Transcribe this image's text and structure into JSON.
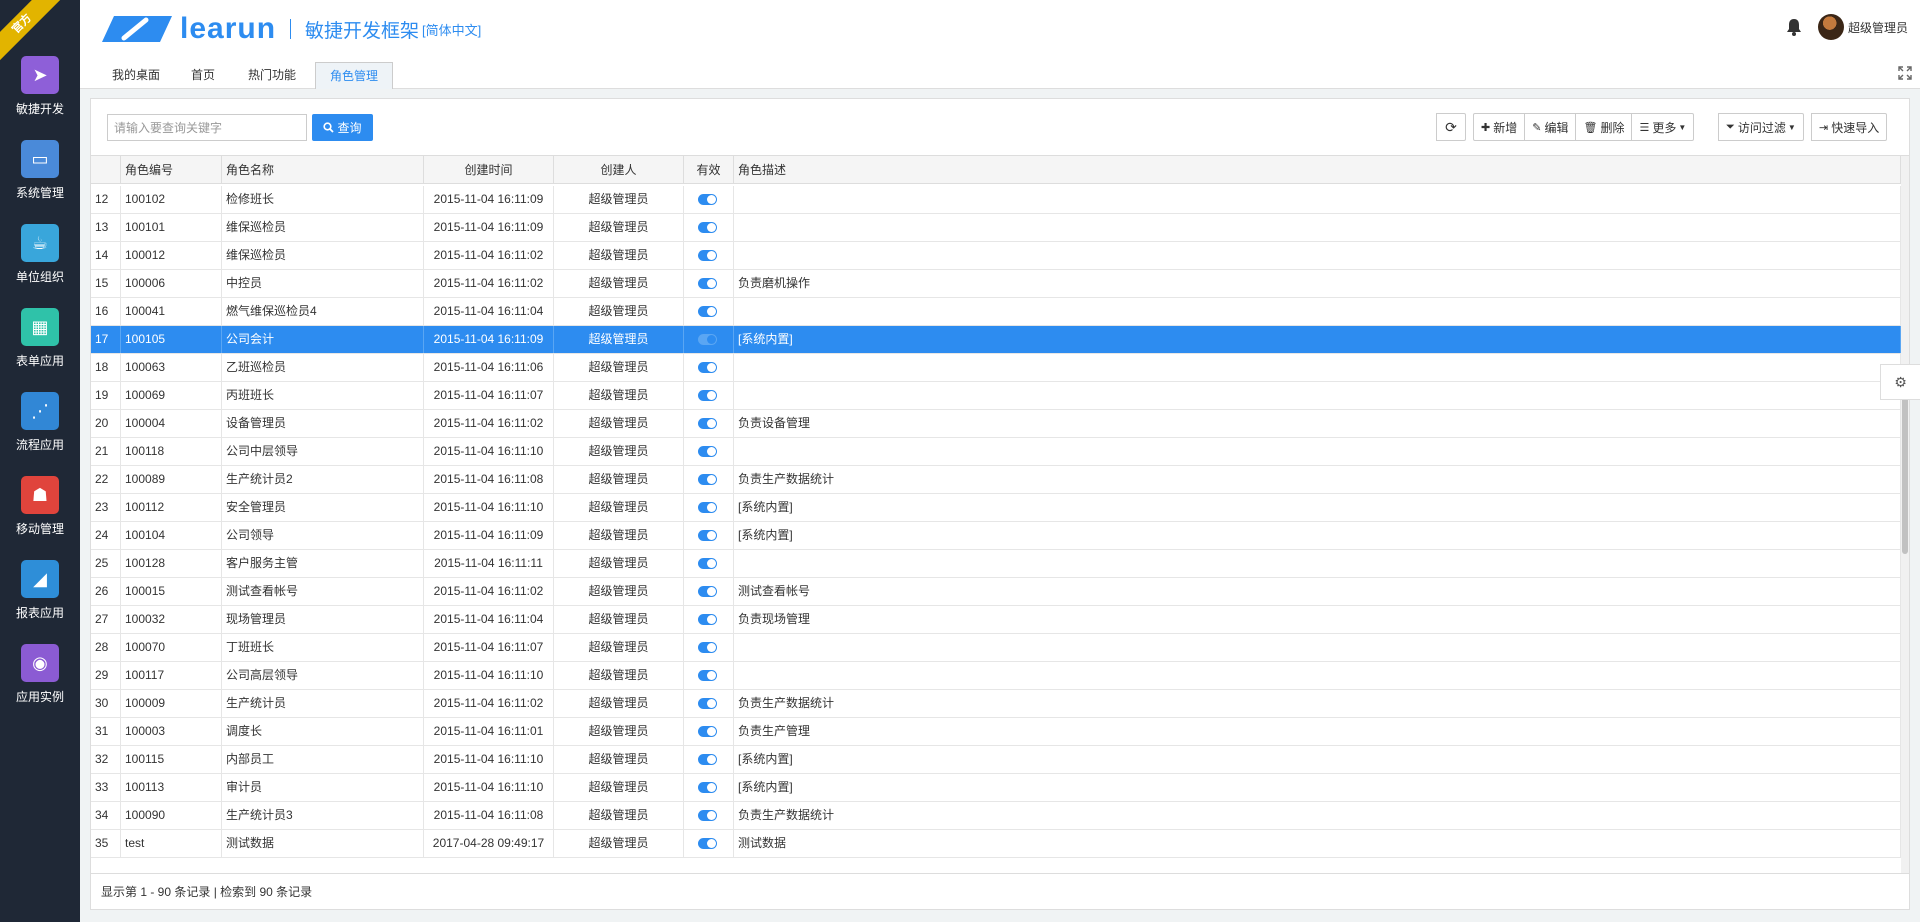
{
  "badge": "官方",
  "colors": {
    "accent": "#2d8cf0",
    "sidebar_bg": "#1f2836",
    "ribbon": "#e2b400"
  },
  "sidebar": {
    "items": [
      {
        "label": "敏捷开发",
        "icon": "paper-plane-icon",
        "color": "#8e5fd8"
      },
      {
        "label": "系统管理",
        "icon": "monitor-icon",
        "color": "#4a8ad9"
      },
      {
        "label": "单位组织",
        "icon": "coffee-icon",
        "color": "#39a6db"
      },
      {
        "label": "表单应用",
        "icon": "table-icon",
        "color": "#2fc2a9"
      },
      {
        "label": "流程应用",
        "icon": "share-icon",
        "color": "#3187d6"
      },
      {
        "label": "移动管理",
        "icon": "android-icon",
        "color": "#e0443c"
      },
      {
        "label": "报表应用",
        "icon": "chart-icon",
        "color": "#2e8ed8"
      },
      {
        "label": "应用实例",
        "icon": "globe-icon",
        "color": "#8b5bd3"
      }
    ]
  },
  "header": {
    "brand": "learun",
    "subtitle": "敏捷开发框架",
    "lang": "[简体中文]",
    "user": "超级管理员"
  },
  "tabs": [
    {
      "label": "我的桌面"
    },
    {
      "label": "首页"
    },
    {
      "label": "热门功能"
    },
    {
      "label": "角色管理",
      "active": true
    }
  ],
  "toolbar": {
    "search_placeholder": "请输入要查询关键字",
    "query": "查询",
    "refresh_icon": "refresh-icon",
    "add": "新增",
    "edit": "编辑",
    "delete": "删除",
    "more": "更多",
    "filter": "访问过滤",
    "import": "快速导入"
  },
  "grid": {
    "columns": [
      "",
      "角色编号",
      "角色名称",
      "创建时间",
      "创建人",
      "有效",
      "角色描述"
    ],
    "selected_index": 17,
    "rows": [
      {
        "n": "12",
        "code": "100102",
        "name": "检修班长",
        "time": "2015-11-04 16:11:09",
        "creator": "超级管理员",
        "desc": ""
      },
      {
        "n": "13",
        "code": "100101",
        "name": "维保巡检员",
        "time": "2015-11-04 16:11:09",
        "creator": "超级管理员",
        "desc": ""
      },
      {
        "n": "14",
        "code": "100012",
        "name": "维保巡检员",
        "time": "2015-11-04 16:11:02",
        "creator": "超级管理员",
        "desc": ""
      },
      {
        "n": "15",
        "code": "100006",
        "name": "中控员",
        "time": "2015-11-04 16:11:02",
        "creator": "超级管理员",
        "desc": "负责磨机操作"
      },
      {
        "n": "16",
        "code": "100041",
        "name": "燃气维保巡检员4",
        "time": "2015-11-04 16:11:04",
        "creator": "超级管理员",
        "desc": ""
      },
      {
        "n": "17",
        "code": "100105",
        "name": "公司会计",
        "time": "2015-11-04 16:11:09",
        "creator": "超级管理员",
        "desc": "[系统内置]"
      },
      {
        "n": "18",
        "code": "100063",
        "name": "乙班巡检员",
        "time": "2015-11-04 16:11:06",
        "creator": "超级管理员",
        "desc": ""
      },
      {
        "n": "19",
        "code": "100069",
        "name": "丙班班长",
        "time": "2015-11-04 16:11:07",
        "creator": "超级管理员",
        "desc": ""
      },
      {
        "n": "20",
        "code": "100004",
        "name": "设备管理员",
        "time": "2015-11-04 16:11:02",
        "creator": "超级管理员",
        "desc": "负责设备管理"
      },
      {
        "n": "21",
        "code": "100118",
        "name": "公司中层领导",
        "time": "2015-11-04 16:11:10",
        "creator": "超级管理员",
        "desc": ""
      },
      {
        "n": "22",
        "code": "100089",
        "name": "生产统计员2",
        "time": "2015-11-04 16:11:08",
        "creator": "超级管理员",
        "desc": "负责生产数据统计"
      },
      {
        "n": "23",
        "code": "100112",
        "name": "安全管理员",
        "time": "2015-11-04 16:11:10",
        "creator": "超级管理员",
        "desc": "[系统内置]"
      },
      {
        "n": "24",
        "code": "100104",
        "name": "公司领导",
        "time": "2015-11-04 16:11:09",
        "creator": "超级管理员",
        "desc": "[系统内置]"
      },
      {
        "n": "25",
        "code": "100128",
        "name": "客户服务主管",
        "time": "2015-11-04 16:11:11",
        "creator": "超级管理员",
        "desc": ""
      },
      {
        "n": "26",
        "code": "100015",
        "name": "测试查看帐号",
        "time": "2015-11-04 16:11:02",
        "creator": "超级管理员",
        "desc": "测试查看帐号"
      },
      {
        "n": "27",
        "code": "100032",
        "name": "现场管理员",
        "time": "2015-11-04 16:11:04",
        "creator": "超级管理员",
        "desc": "负责现场管理"
      },
      {
        "n": "28",
        "code": "100070",
        "name": "丁班班长",
        "time": "2015-11-04 16:11:07",
        "creator": "超级管理员",
        "desc": ""
      },
      {
        "n": "29",
        "code": "100117",
        "name": "公司高层领导",
        "time": "2015-11-04 16:11:10",
        "creator": "超级管理员",
        "desc": ""
      },
      {
        "n": "30",
        "code": "100009",
        "name": "生产统计员",
        "time": "2015-11-04 16:11:02",
        "creator": "超级管理员",
        "desc": "负责生产数据统计"
      },
      {
        "n": "31",
        "code": "100003",
        "name": "调度长",
        "time": "2015-11-04 16:11:01",
        "creator": "超级管理员",
        "desc": "负责生产管理"
      },
      {
        "n": "32",
        "code": "100115",
        "name": "内部员工",
        "time": "2015-11-04 16:11:10",
        "creator": "超级管理员",
        "desc": "[系统内置]"
      },
      {
        "n": "33",
        "code": "100113",
        "name": "审计员",
        "time": "2015-11-04 16:11:10",
        "creator": "超级管理员",
        "desc": "[系统内置]"
      },
      {
        "n": "34",
        "code": "100090",
        "name": "生产统计员3",
        "time": "2015-11-04 16:11:08",
        "creator": "超级管理员",
        "desc": "负责生产数据统计"
      },
      {
        "n": "35",
        "code": "test",
        "name": "测试数据",
        "time": "2017-04-28 09:49:17",
        "creator": "超级管理员",
        "desc": "测试数据"
      }
    ]
  },
  "pager": "显示第 1 - 90 条记录 | 检索到 90 条记录"
}
